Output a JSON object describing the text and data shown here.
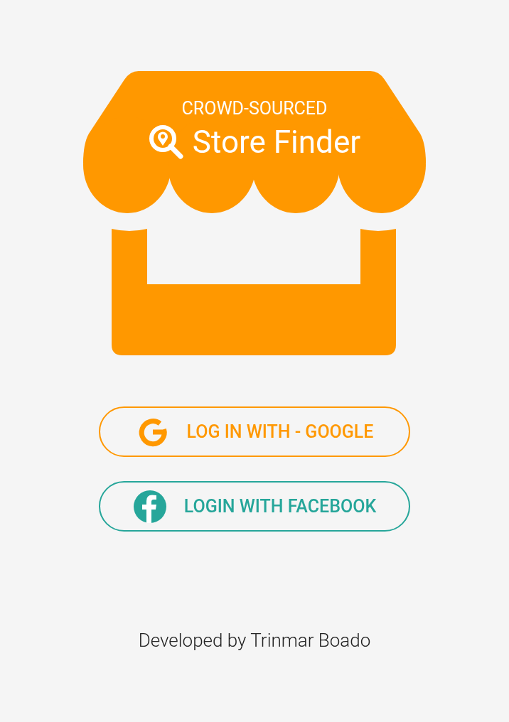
{
  "logo": {
    "subtitle": "CROWD-SOURCED",
    "title": "Store Finder"
  },
  "buttons": [
    {
      "kind": "google",
      "label": "LOG IN WITH - GOOGLE"
    },
    {
      "kind": "facebook",
      "label": "LOGIN WITH FACEBOOK"
    }
  ],
  "footer": "Developed by Trinmar Boado"
}
